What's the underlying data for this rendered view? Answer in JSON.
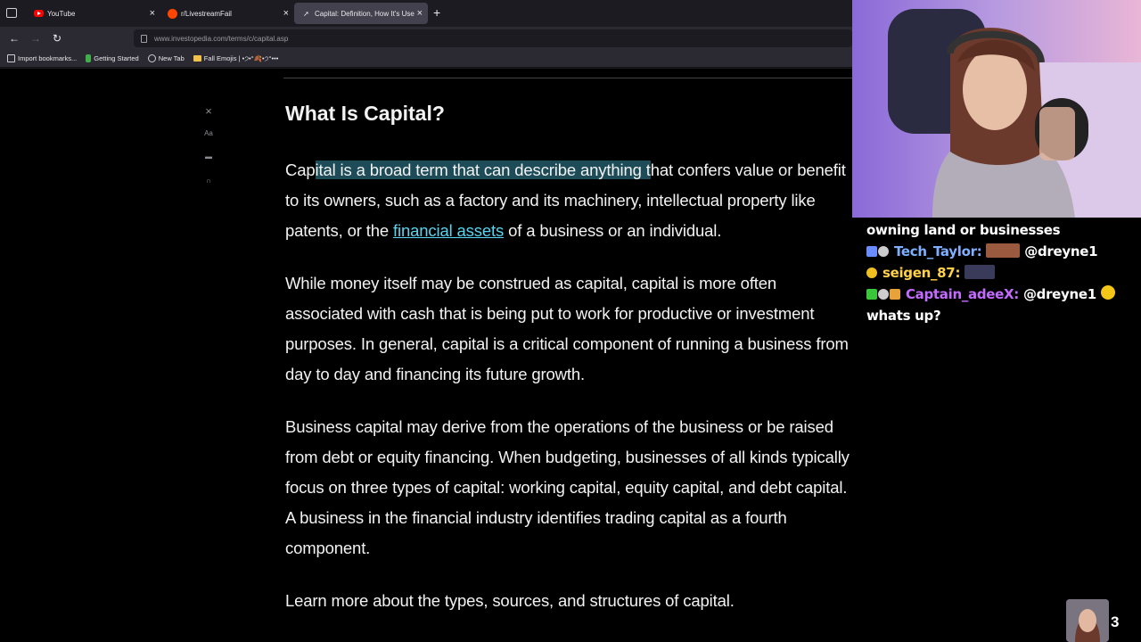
{
  "tabs": [
    {
      "label": "YouTube",
      "icon": "youtube-icon"
    },
    {
      "label": "r/LivestreamFail",
      "icon": "reddit-icon"
    },
    {
      "label": "Capital: Definition, How It's Use",
      "icon": "investopedia-icon"
    }
  ],
  "url": "www.investopedia.com/terms/c/capital.asp",
  "bookmarks": [
    "Import bookmarks...",
    "Getting Started",
    "New Tab",
    "Fall Emojis | •੭•°🍂•੭°•••"
  ],
  "reader_tools": {
    "font_label": "Aa"
  },
  "article": {
    "title": "What Is Capital?",
    "p1_before": "Cap",
    "p1_highlight": "ital is a broad term that can describe anything t",
    "p1_after": "hat confers value or benefit to its owners, such as a factory and its machinery, intellectual property like patents, or the ",
    "p1_link": "financial assets",
    "p1_end": " of a business or an individual.",
    "p2": "While money itself may be construed as capital, capital is more often associated with cash that is being put to work for productive or investment purposes. In general, capital is a critical component of running a business from day to day and financing its future growth.",
    "p3": "Business capital may derive from the operations of the business or be raised from debt or equity financing. When budgeting, businesses of all kinds typically focus on three types of capital: working capital, equity capital, and debt capital. A business in the financial industry identifies trading capital as a fourth component.",
    "p4": "Learn more about the types, sources, and structures of capital."
  },
  "chat": [
    {
      "user": "",
      "text": "owning land or businesses"
    },
    {
      "user": "Tech_Taylor:",
      "text": "@dreyne1"
    },
    {
      "user": "seigen_87:",
      "text": ""
    },
    {
      "user": "Captain_adeeX:",
      "text": "@dreyne1"
    },
    {
      "user": "",
      "text": "whats up?"
    }
  ],
  "viewer_count": "3",
  "colors": {
    "link": "#5ad4f0",
    "highlight": "#1d4b57",
    "chat_user1": "#7fb0ff",
    "chat_user2": "#ffd24a",
    "chat_user3": "#c46bff"
  }
}
